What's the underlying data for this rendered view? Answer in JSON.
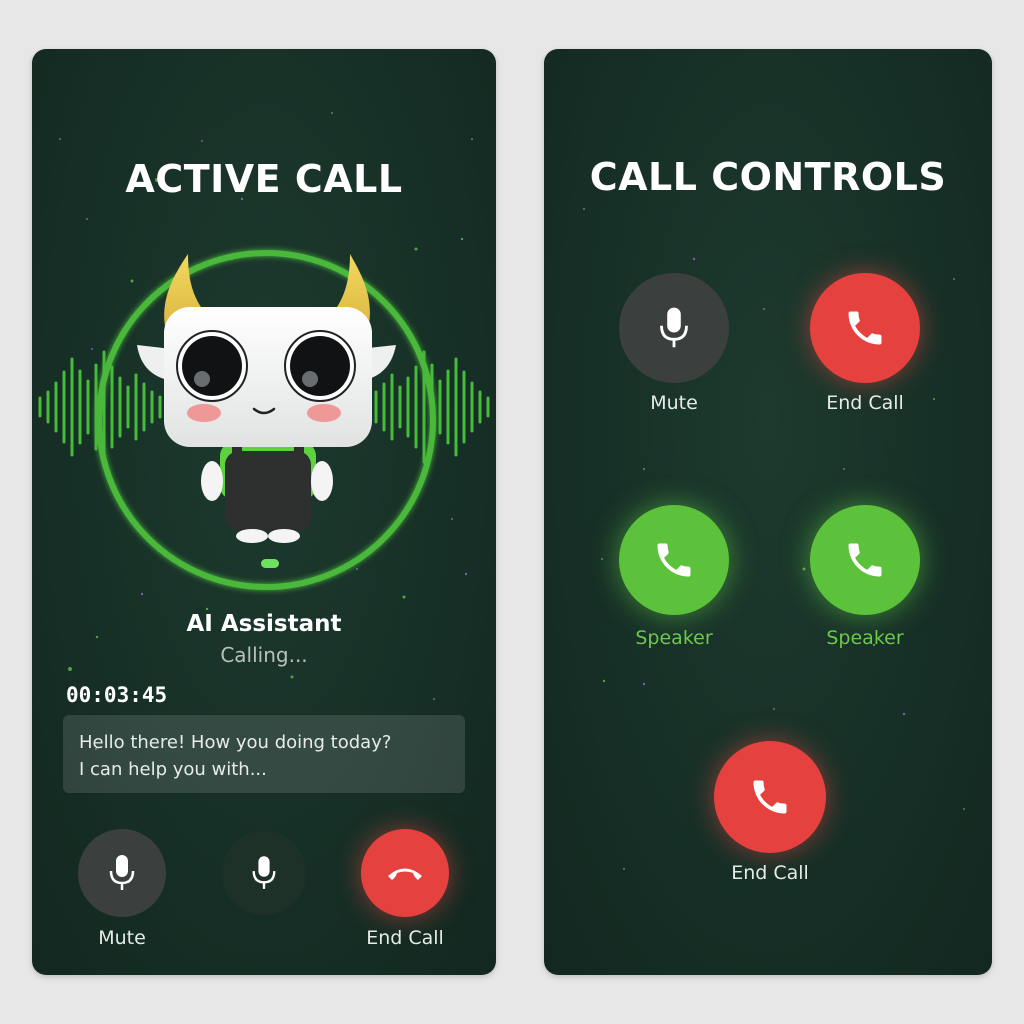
{
  "left_panel": {
    "title": "ACTIVE CALL",
    "caller_name": "AI Assistant",
    "call_status": "Calling...",
    "timer": "00:03:45",
    "message_lines": [
      "Hello there! How you doing today?",
      "I can help you with..."
    ],
    "controls": {
      "mute_label": "Mute",
      "end_call_label": "End Call"
    }
  },
  "right_panel": {
    "title": "CALL CONTROLS",
    "buttons": {
      "mute_label": "Mute",
      "end_call_top_label": "End Call",
      "speaker_left_label": "Speaker",
      "speaker_right_label": "Speaker",
      "end_call_bottom_label": "End Call"
    }
  },
  "colors": {
    "background": "#e6e7e6",
    "panel": "#173027",
    "accent_green": "#5cc23b",
    "end_call_red": "#e5423f",
    "mute_gray": "#3b3f3d"
  },
  "icons": [
    "microphone-icon",
    "phone-icon",
    "hang-up-icon"
  ]
}
